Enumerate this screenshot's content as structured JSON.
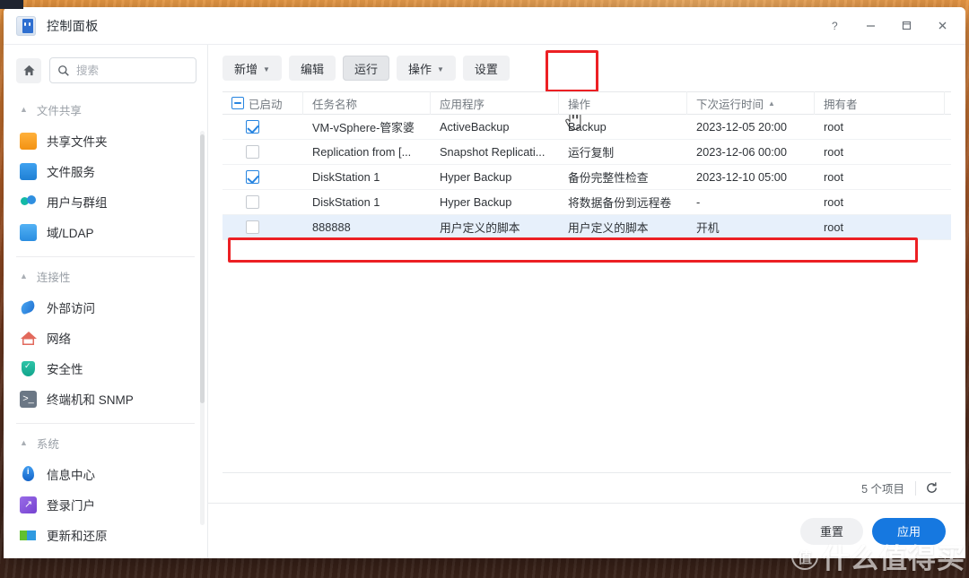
{
  "window": {
    "title": "控制面板",
    "app_icon": "control-panel-icon",
    "controls": {
      "help": "?",
      "minimize": "—",
      "maximize": "▢",
      "close": "✕"
    }
  },
  "sidebar": {
    "home_icon": "home-icon",
    "search": {
      "placeholder": "搜索",
      "value": "",
      "icon": "search-icon"
    },
    "sections": [
      {
        "title": "文件共享",
        "caret": "chevron-up-icon",
        "items": [
          {
            "label": "共享文件夹",
            "icon": "shared-folder-icon",
            "icon_class": "ic-folder"
          },
          {
            "label": "文件服务",
            "icon": "file-service-icon",
            "icon_class": "ic-fileserv"
          },
          {
            "label": "用户与群组",
            "icon": "users-groups-icon",
            "icon_class": "ic-users"
          },
          {
            "label": "域/LDAP",
            "icon": "domain-ldap-icon",
            "icon_class": "ic-ldap"
          }
        ]
      },
      {
        "title": "连接性",
        "caret": "chevron-up-icon",
        "items": [
          {
            "label": "外部访问",
            "icon": "external-access-icon",
            "icon_class": "ic-ext"
          },
          {
            "label": "网络",
            "icon": "network-icon",
            "icon_class": "ic-network"
          },
          {
            "label": "安全性",
            "icon": "security-icon",
            "icon_class": "ic-security"
          },
          {
            "label": "终端机和 SNMP",
            "icon": "terminal-snmp-icon",
            "icon_class": "ic-terminal"
          }
        ]
      },
      {
        "title": "系统",
        "caret": "chevron-up-icon",
        "items": [
          {
            "label": "信息中心",
            "icon": "info-center-icon",
            "icon_class": "ic-info"
          },
          {
            "label": "登录门户",
            "icon": "login-portal-icon",
            "icon_class": "ic-portal"
          },
          {
            "label": "更新和还原",
            "icon": "update-restore-icon",
            "icon_class": "ic-update"
          }
        ]
      }
    ]
  },
  "toolbar": {
    "buttons": [
      {
        "label": "新增",
        "has_caret": true,
        "active": false
      },
      {
        "label": "编辑",
        "has_caret": false,
        "active": false
      },
      {
        "label": "运行",
        "has_caret": false,
        "active": true
      },
      {
        "label": "操作",
        "has_caret": true,
        "active": false
      },
      {
        "label": "设置",
        "has_caret": false,
        "active": false
      }
    ],
    "highlight_target": "运行",
    "cursor": "hand-pointer-cursor"
  },
  "table": {
    "columns": [
      {
        "label": "已启动",
        "sorted": false
      },
      {
        "label": "任务名称",
        "sorted": false
      },
      {
        "label": "应用程序",
        "sorted": false
      },
      {
        "label": "操作",
        "sorted": false
      },
      {
        "label": "下次运行时间",
        "sorted": true,
        "sort_dir": "▲"
      },
      {
        "label": "拥有者",
        "sorted": false
      },
      {
        "label": "",
        "sorted": false
      }
    ],
    "header_checkbox_state": "indeterminate",
    "rows": [
      {
        "enabled": true,
        "name": "VM-vSphere-管家婆",
        "app": "ActiveBackup",
        "action": "Backup",
        "next_run": "2023-12-05 20:00",
        "owner": "root",
        "selected": false
      },
      {
        "enabled": false,
        "name": "Replication from [...",
        "app": "Snapshot Replicati...",
        "action": "运行复制",
        "next_run": "2023-12-06 00:00",
        "owner": "root",
        "selected": false
      },
      {
        "enabled": true,
        "name": "DiskStation 1",
        "app": "Hyper Backup",
        "action": "备份完整性检查",
        "next_run": "2023-12-10 05:00",
        "owner": "root",
        "selected": false
      },
      {
        "enabled": false,
        "name": "DiskStation 1",
        "app": "Hyper Backup",
        "action": "将数据备份到远程卷",
        "next_run": "-",
        "owner": "root",
        "selected": false
      },
      {
        "enabled": false,
        "name": "888888",
        "app": "用户定义的脚本",
        "action": "用户定义的脚本",
        "next_run": "开机",
        "owner": "root",
        "selected": true
      }
    ],
    "footer": {
      "count_text": "5 个项目",
      "refresh_icon": "refresh-icon"
    }
  },
  "action_bar": {
    "reset_label": "重置",
    "apply_label": "应用"
  },
  "watermark": {
    "logo": "值",
    "text": "什么值得买"
  },
  "colors": {
    "accent_blue": "#1678e0",
    "highlight_red": "#ec2024",
    "selected_row": "#e7f0fb",
    "toolbar_btn": "#f0f1f3",
    "desktop_orange": "#c9651f"
  }
}
